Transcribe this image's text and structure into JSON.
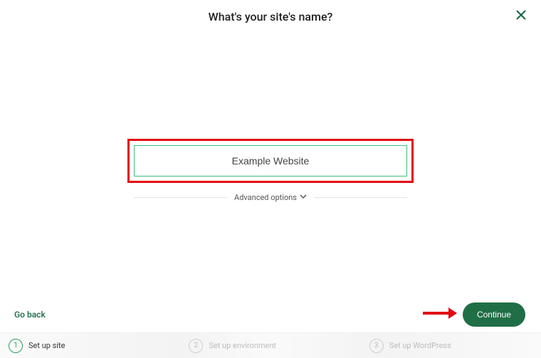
{
  "header": {
    "title": "What's your site's name?"
  },
  "form": {
    "site_name_value": "Example Website",
    "advanced_label": "Advanced options"
  },
  "footer": {
    "go_back_label": "Go back",
    "continue_label": "Continue"
  },
  "steps": [
    {
      "num": "1",
      "label": "Set up site",
      "active": true
    },
    {
      "num": "2",
      "label": "Set up environment",
      "active": false
    },
    {
      "num": "3",
      "label": "Set up WordPress",
      "active": false
    }
  ],
  "colors": {
    "brand_green": "#206e46",
    "highlight_red": "#e30613",
    "input_border_green": "#3cbf7a"
  }
}
